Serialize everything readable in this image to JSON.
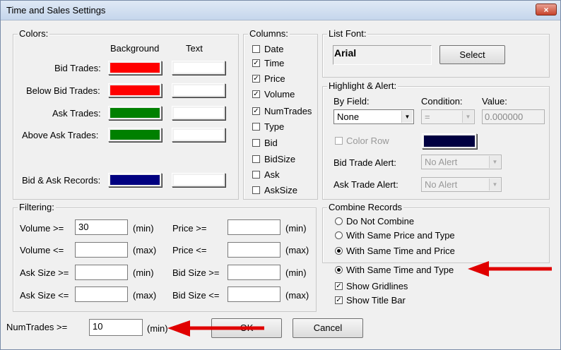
{
  "window": {
    "title": "Time and Sales Settings",
    "close_glyph": "×"
  },
  "colors": {
    "label": "Colors:",
    "header_background": "Background",
    "header_text": "Text",
    "rows": [
      {
        "label": "Bid Trades:",
        "bg": "#ff0000",
        "text_color": "#ffffff"
      },
      {
        "label": "Below Bid Trades:",
        "bg": "#ff0000",
        "text_color": "#ffffff"
      },
      {
        "label": "Ask Trades:",
        "bg": "#008000",
        "text_color": "#ffffff"
      },
      {
        "label": "Above Ask Trades:",
        "bg": "#008000",
        "text_color": "#ffffff"
      },
      {
        "label": "Bid & Ask Records:",
        "bg": "#000080",
        "text_color": "#ffffff"
      }
    ]
  },
  "columns": {
    "label": "Columns:",
    "items": [
      {
        "label": "Date",
        "checked": false
      },
      {
        "label": "Time",
        "checked": true
      },
      {
        "label": "Price",
        "checked": true
      },
      {
        "label": "Volume",
        "checked": true
      },
      {
        "label": "NumTrades",
        "checked": true
      },
      {
        "label": "Type",
        "checked": false
      },
      {
        "label": "Bid",
        "checked": false
      },
      {
        "label": "BidSize",
        "checked": false
      },
      {
        "label": "Ask",
        "checked": false
      },
      {
        "label": "AskSize",
        "checked": false
      }
    ]
  },
  "list_font": {
    "label": "List Font:",
    "value": "Arial",
    "select_label": "Select"
  },
  "highlight": {
    "label": "Highlight & Alert:",
    "by_field_label": "By Field:",
    "by_field_value": "None",
    "condition_label": "Condition:",
    "condition_value": "=",
    "value_label": "Value:",
    "value_value": "0.000000",
    "color_row_label": "Color Row",
    "color_row_swatch": "#000040",
    "bid_alert_label": "Bid Trade Alert:",
    "bid_alert_value": "No Alert",
    "ask_alert_label": "Ask Trade Alert:",
    "ask_alert_value": "No Alert"
  },
  "filtering": {
    "label": "Filtering:",
    "unit_min": "(min)",
    "unit_max": "(max)",
    "left": [
      {
        "label": "Volume >=",
        "value": "30",
        "unit": "(min)"
      },
      {
        "label": "Volume <=",
        "value": "",
        "unit": "(max)"
      },
      {
        "label": "Ask Size >=",
        "value": "",
        "unit": "(min)"
      },
      {
        "label": "Ask Size <=",
        "value": "",
        "unit": "(max)"
      }
    ],
    "right": [
      {
        "label": "Price >=",
        "value": "",
        "unit": "(min)"
      },
      {
        "label": "Price <=",
        "value": "",
        "unit": "(max)"
      },
      {
        "label": "Bid Size >=",
        "value": "",
        "unit": "(min)"
      },
      {
        "label": "Bid Size <=",
        "value": "",
        "unit": "(max)"
      }
    ]
  },
  "combine": {
    "label": "Combine Records",
    "options": [
      {
        "label": "Do Not Combine",
        "selected": false
      },
      {
        "label": "With Same Price and Type",
        "selected": false
      },
      {
        "label": "With Same Time and Price",
        "selected": true
      },
      {
        "label": "With Same Time and  Type",
        "selected": true
      }
    ]
  },
  "show_gridlines": {
    "label": "Show Gridlines",
    "checked": true
  },
  "show_title_bar": {
    "label": "Show Title Bar",
    "checked": true
  },
  "numtrades": {
    "label": "NumTrades  >=",
    "value": "10",
    "unit": "(min)"
  },
  "buttons": {
    "ok": "OK",
    "cancel": "Cancel"
  },
  "annotation_color": "#e00000"
}
